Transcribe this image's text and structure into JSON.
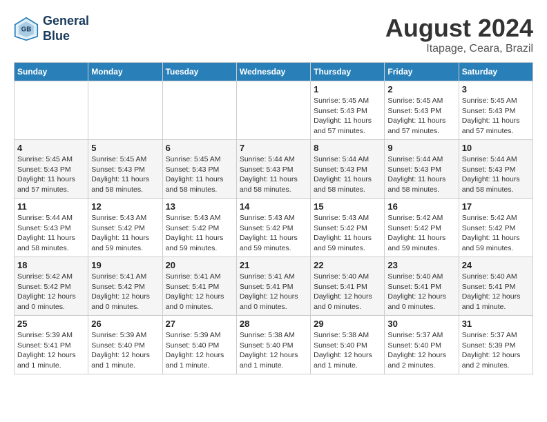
{
  "header": {
    "logo_line1": "General",
    "logo_line2": "Blue",
    "month": "August 2024",
    "location": "Itapage, Ceara, Brazil"
  },
  "weekdays": [
    "Sunday",
    "Monday",
    "Tuesday",
    "Wednesday",
    "Thursday",
    "Friday",
    "Saturday"
  ],
  "weeks": [
    [
      {
        "day": "",
        "info": ""
      },
      {
        "day": "",
        "info": ""
      },
      {
        "day": "",
        "info": ""
      },
      {
        "day": "",
        "info": ""
      },
      {
        "day": "1",
        "info": "Sunrise: 5:45 AM\nSunset: 5:43 PM\nDaylight: 11 hours\nand 57 minutes."
      },
      {
        "day": "2",
        "info": "Sunrise: 5:45 AM\nSunset: 5:43 PM\nDaylight: 11 hours\nand 57 minutes."
      },
      {
        "day": "3",
        "info": "Sunrise: 5:45 AM\nSunset: 5:43 PM\nDaylight: 11 hours\nand 57 minutes."
      }
    ],
    [
      {
        "day": "4",
        "info": "Sunrise: 5:45 AM\nSunset: 5:43 PM\nDaylight: 11 hours\nand 57 minutes."
      },
      {
        "day": "5",
        "info": "Sunrise: 5:45 AM\nSunset: 5:43 PM\nDaylight: 11 hours\nand 58 minutes."
      },
      {
        "day": "6",
        "info": "Sunrise: 5:45 AM\nSunset: 5:43 PM\nDaylight: 11 hours\nand 58 minutes."
      },
      {
        "day": "7",
        "info": "Sunrise: 5:44 AM\nSunset: 5:43 PM\nDaylight: 11 hours\nand 58 minutes."
      },
      {
        "day": "8",
        "info": "Sunrise: 5:44 AM\nSunset: 5:43 PM\nDaylight: 11 hours\nand 58 minutes."
      },
      {
        "day": "9",
        "info": "Sunrise: 5:44 AM\nSunset: 5:43 PM\nDaylight: 11 hours\nand 58 minutes."
      },
      {
        "day": "10",
        "info": "Sunrise: 5:44 AM\nSunset: 5:43 PM\nDaylight: 11 hours\nand 58 minutes."
      }
    ],
    [
      {
        "day": "11",
        "info": "Sunrise: 5:44 AM\nSunset: 5:43 PM\nDaylight: 11 hours\nand 58 minutes."
      },
      {
        "day": "12",
        "info": "Sunrise: 5:43 AM\nSunset: 5:42 PM\nDaylight: 11 hours\nand 59 minutes."
      },
      {
        "day": "13",
        "info": "Sunrise: 5:43 AM\nSunset: 5:42 PM\nDaylight: 11 hours\nand 59 minutes."
      },
      {
        "day": "14",
        "info": "Sunrise: 5:43 AM\nSunset: 5:42 PM\nDaylight: 11 hours\nand 59 minutes."
      },
      {
        "day": "15",
        "info": "Sunrise: 5:43 AM\nSunset: 5:42 PM\nDaylight: 11 hours\nand 59 minutes."
      },
      {
        "day": "16",
        "info": "Sunrise: 5:42 AM\nSunset: 5:42 PM\nDaylight: 11 hours\nand 59 minutes."
      },
      {
        "day": "17",
        "info": "Sunrise: 5:42 AM\nSunset: 5:42 PM\nDaylight: 11 hours\nand 59 minutes."
      }
    ],
    [
      {
        "day": "18",
        "info": "Sunrise: 5:42 AM\nSunset: 5:42 PM\nDaylight: 12 hours\nand 0 minutes."
      },
      {
        "day": "19",
        "info": "Sunrise: 5:41 AM\nSunset: 5:42 PM\nDaylight: 12 hours\nand 0 minutes."
      },
      {
        "day": "20",
        "info": "Sunrise: 5:41 AM\nSunset: 5:41 PM\nDaylight: 12 hours\nand 0 minutes."
      },
      {
        "day": "21",
        "info": "Sunrise: 5:41 AM\nSunset: 5:41 PM\nDaylight: 12 hours\nand 0 minutes."
      },
      {
        "day": "22",
        "info": "Sunrise: 5:40 AM\nSunset: 5:41 PM\nDaylight: 12 hours\nand 0 minutes."
      },
      {
        "day": "23",
        "info": "Sunrise: 5:40 AM\nSunset: 5:41 PM\nDaylight: 12 hours\nand 0 minutes."
      },
      {
        "day": "24",
        "info": "Sunrise: 5:40 AM\nSunset: 5:41 PM\nDaylight: 12 hours\nand 1 minute."
      }
    ],
    [
      {
        "day": "25",
        "info": "Sunrise: 5:39 AM\nSunset: 5:41 PM\nDaylight: 12 hours\nand 1 minute."
      },
      {
        "day": "26",
        "info": "Sunrise: 5:39 AM\nSunset: 5:40 PM\nDaylight: 12 hours\nand 1 minute."
      },
      {
        "day": "27",
        "info": "Sunrise: 5:39 AM\nSunset: 5:40 PM\nDaylight: 12 hours\nand 1 minute."
      },
      {
        "day": "28",
        "info": "Sunrise: 5:38 AM\nSunset: 5:40 PM\nDaylight: 12 hours\nand 1 minute."
      },
      {
        "day": "29",
        "info": "Sunrise: 5:38 AM\nSunset: 5:40 PM\nDaylight: 12 hours\nand 1 minute."
      },
      {
        "day": "30",
        "info": "Sunrise: 5:37 AM\nSunset: 5:40 PM\nDaylight: 12 hours\nand 2 minutes."
      },
      {
        "day": "31",
        "info": "Sunrise: 5:37 AM\nSunset: 5:39 PM\nDaylight: 12 hours\nand 2 minutes."
      }
    ]
  ]
}
